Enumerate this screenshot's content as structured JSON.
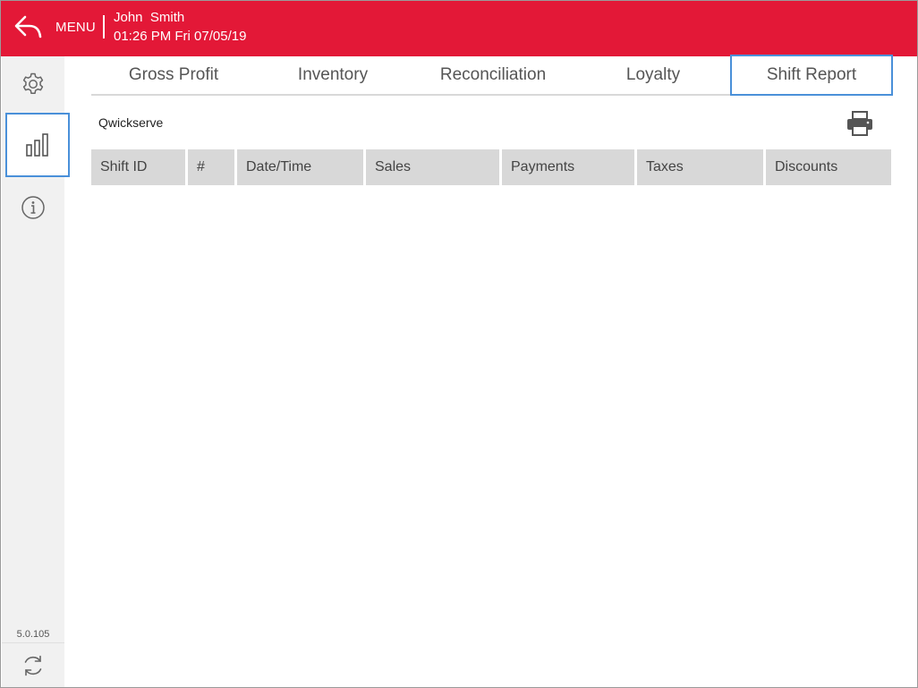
{
  "header": {
    "menu_label": "MENU",
    "user_name": "John  Smith",
    "datetime": "01:26 PM Fri 07/05/19",
    "accent_color": "#e31837"
  },
  "sidebar": {
    "items": [
      {
        "icon": "gear-icon",
        "active": false
      },
      {
        "icon": "bar-chart-icon",
        "active": true
      },
      {
        "icon": "info-icon",
        "active": false
      }
    ],
    "version": "5.0.105",
    "sync_icon": "sync-icon"
  },
  "tabs": [
    {
      "label": "Gross Profit",
      "active": false
    },
    {
      "label": "Inventory",
      "active": false
    },
    {
      "label": "Reconciliation",
      "active": false
    },
    {
      "label": "Loyalty",
      "active": false
    },
    {
      "label": "Shift Report",
      "active": true
    }
  ],
  "store_name": "Qwickserve",
  "table": {
    "columns": [
      "Shift ID",
      "#",
      "Date/Time",
      "Sales",
      "Payments",
      "Taxes",
      "Discounts"
    ],
    "rows": []
  }
}
